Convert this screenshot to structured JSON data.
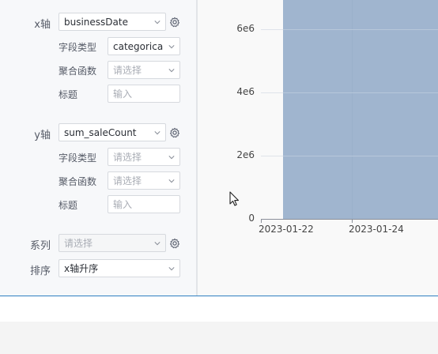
{
  "x_axis": {
    "label": "x轴",
    "field": "businessDate",
    "field_type_label": "字段类型",
    "field_type_value": "categorica",
    "agg_label": "聚合函数",
    "agg_placeholder": "请选择",
    "title_label": "标题",
    "title_placeholder": "输入"
  },
  "y_axis": {
    "label": "y轴",
    "field": "sum_saleCount",
    "field_type_label": "字段类型",
    "field_type_placeholder": "请选择",
    "agg_label": "聚合函数",
    "agg_placeholder": "请选择",
    "title_label": "标题",
    "title_placeholder": "输入"
  },
  "series": {
    "label": "系列",
    "placeholder": "请选择"
  },
  "sort": {
    "label": "排序",
    "value": "x轴升序"
  },
  "chart": {
    "y_ticks": [
      "6e6",
      "4e6",
      "2e6",
      "0"
    ],
    "x_ticks": [
      "2023-01-22",
      "2023-01-24"
    ]
  },
  "colors": {
    "bar": "#a0b5cf",
    "accent_line": "#2f7fc1"
  }
}
